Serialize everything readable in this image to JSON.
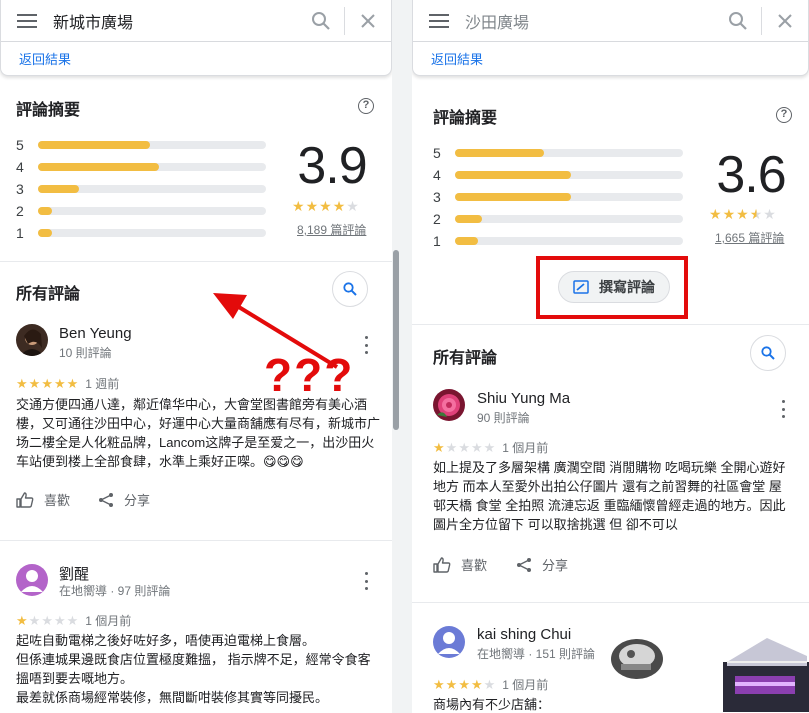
{
  "left": {
    "search_value": "新城市廣場",
    "back_label": "返回結果",
    "summary_title": "評論摘要",
    "help_icon": "?",
    "rating_rows": [
      {
        "label": "5",
        "fill": 0.49
      },
      {
        "label": "4",
        "fill": 0.53
      },
      {
        "label": "3",
        "fill": 0.18
      },
      {
        "label": "2",
        "fill": 0.06
      },
      {
        "label": "1",
        "fill": 0.06
      }
    ],
    "score": "3.9",
    "score_stars": 4,
    "review_count": "8,189 篇評論",
    "all_reviews_title": "所有評論",
    "reviews": [
      {
        "name": "Ben Yeung",
        "meta": "10 則評論",
        "stars": 5,
        "date": "1 週前",
        "text": "交通方便四通八達，鄰近偉华中心，大會堂图書館旁有美心酒樓，又可通往沙田中心，好運中心大量商舖應有尽有，新城市广场二樓全是人化粧品牌，Lancom这牌子是至爱之一，出沙田火车站便到楼上全部食肆，水準上乘好正㗎。😋😋😋",
        "like_label": "喜歡",
        "share_label": "分享"
      },
      {
        "name": "劉醒",
        "meta": "在地嚮導 · 97 則評論",
        "stars": 1,
        "date": "1 個月前",
        "text_lines": [
          "起咗自動電梯之後好咗好多，唔使再迫電梯上食層。",
          "但係連城果邊既食店位置極度難搵， 指示牌不足，經常令食客搵唔到要去嘅地方。",
          "最差就係商場經常裝修，無間斷咁裝修其實等同擾民。"
        ]
      }
    ],
    "annotation": "???"
  },
  "right": {
    "search_value": "沙田廣場",
    "back_label": "返回結果",
    "summary_title": "評論摘要",
    "help_icon": "?",
    "rating_rows": [
      {
        "label": "5",
        "fill": 0.39
      },
      {
        "label": "4",
        "fill": 0.51
      },
      {
        "label": "3",
        "fill": 0.51
      },
      {
        "label": "2",
        "fill": 0.12
      },
      {
        "label": "1",
        "fill": 0.1
      }
    ],
    "score": "3.6",
    "score_stars": 3.5,
    "review_count": "1,665 篇評論",
    "write_review_label": "撰寫評論",
    "all_reviews_title": "所有評論",
    "reviews": [
      {
        "name": "Shiu Yung Ma",
        "meta": "90 則評論",
        "stars": 1,
        "date": "1 個月前",
        "text": "如上提及了多層架構 廣濶空間 消閒購物 吃喝玩樂 全開心遊好地方 而本人至愛外出拍公仔圖片 還有之前習舞的社區會堂 屋邨天橋 食堂 全拍照 流漣忘返 重臨緬懷曾經走過的地方。因此圖片全方位留下 可以取捨挑選 但 卻不可以",
        "like_label": "喜歡",
        "share_label": "分享"
      },
      {
        "name": "kai shing Chui",
        "meta": "在地嚮導 · 151 則評論",
        "stars": 4,
        "date": "1 個月前",
        "text": "商場內有不少店舖："
      }
    ]
  },
  "colors": {
    "star": "#f2bd42",
    "link": "#1a73e8",
    "annotation_red": "#e30b0b"
  }
}
